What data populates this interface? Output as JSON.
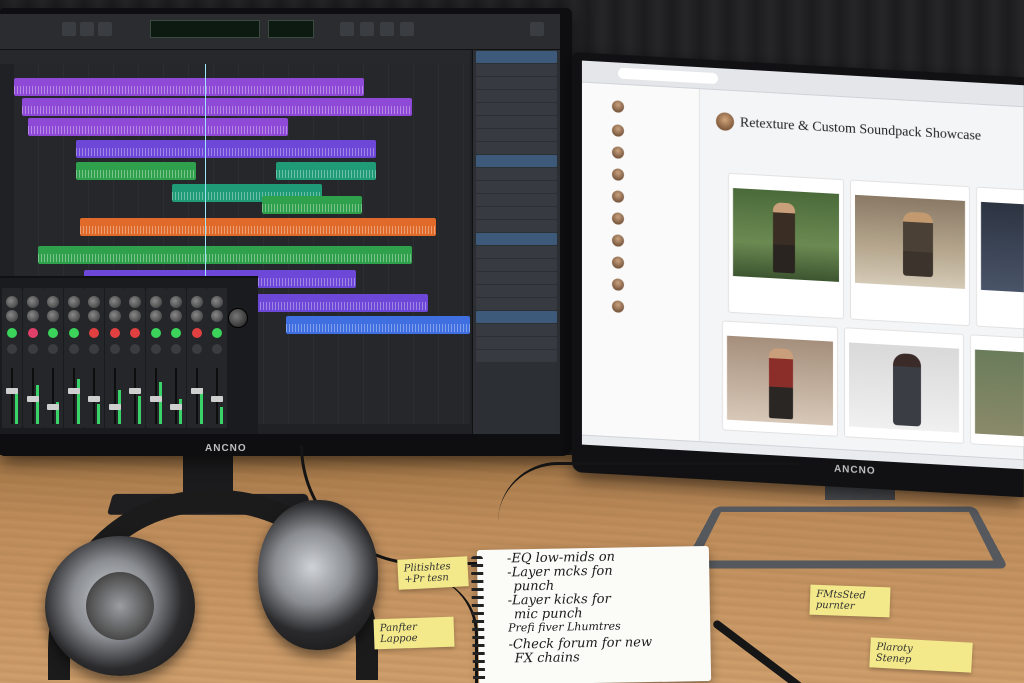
{
  "left_monitor": {
    "brand": "ANCNO",
    "app": "daw",
    "clip_colors": {
      "purple": "#8e4ad6",
      "violet": "#6c47d8",
      "green": "#2fa04c",
      "teal": "#1f9b78",
      "orange": "#e06a2a",
      "blue": "#3f6fe0"
    },
    "mixer_button_colors": [
      "#3bd35a",
      "#e0406a",
      "#3bd35a",
      "#3bd35a",
      "#e04040",
      "#e04040",
      "#e04040",
      "#3bd35a",
      "#3bd35a",
      "#e04040"
    ]
  },
  "right_monitor": {
    "brand": "ANCNO",
    "forum_title": "Retexture & Custom Soundpack Showcase"
  },
  "notepad": {
    "lines": [
      "-EQ low-mids on",
      "-Layer mcks fon",
      "punch",
      "-Layer kicks for",
      "mic punch",
      "Prefi fiver Lhumtres",
      "-Check forum for new",
      "FX chains"
    ]
  },
  "stickies": {
    "a": "Plitishtes\n+Pr tesn",
    "b": "Panfter\nLappoe",
    "c": "FMtsSted\npurnter",
    "d": "Plaroty\nStenep"
  }
}
